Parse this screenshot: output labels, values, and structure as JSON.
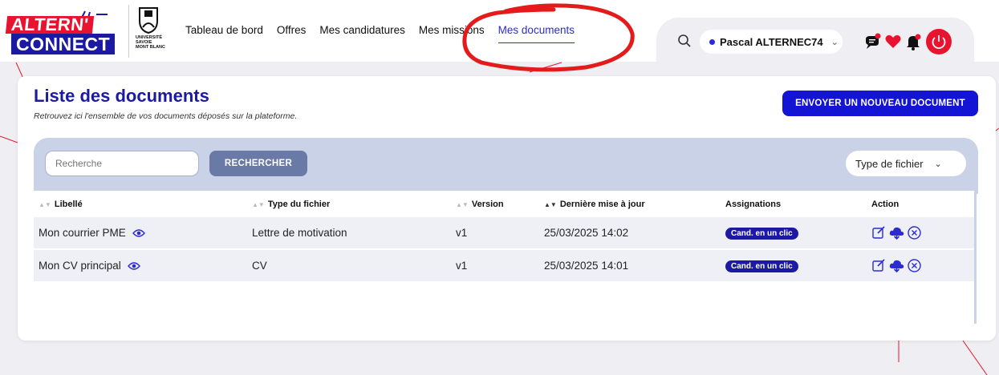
{
  "colors": {
    "brand_blue": "#1c1aa3",
    "brand_red": "#e8142f",
    "accent": "#2b2bd1",
    "panel": "#c9d2e6",
    "row": "#eef0f6"
  },
  "logo": {
    "line1": "ALTERN'",
    "line2": "CONNECT"
  },
  "university": {
    "line1": "UNIVERSITÉ",
    "line2": "SAVOIE",
    "line3": "MONT BLANC"
  },
  "nav": {
    "dashboard": "Tableau de bord",
    "offers": "Offres",
    "applications": "Mes candidatures",
    "missions": "Mes missions",
    "documents": "Mes documents"
  },
  "user": {
    "name": "Pascal ALTERNEC74"
  },
  "page": {
    "title": "Liste des documents",
    "subtitle": "Retrouvez ici l'ensemble de vos documents déposés sur la plateforme.",
    "send_button": "ENVOYER UN NOUVEAU DOCUMENT"
  },
  "search": {
    "placeholder": "Recherche",
    "button": "RECHERCHER",
    "type_filter": "Type de fichier"
  },
  "table": {
    "headers": {
      "label": "Libellé",
      "type": "Type du fichier",
      "version": "Version",
      "updated": "Dernière mise à jour",
      "assignments": "Assignations",
      "action": "Action"
    },
    "rows": [
      {
        "label": "Mon courrier PME",
        "type": "Lettre de motivation",
        "version": "v1",
        "updated": "25/03/2025 14:02",
        "assignment": "Cand. en un clic"
      },
      {
        "label": "Mon CV principal",
        "type": "CV",
        "version": "v1",
        "updated": "25/03/2025 14:01",
        "assignment": "Cand. en un clic"
      }
    ]
  },
  "icons": {
    "search": "search-icon",
    "chat": "chat-icon",
    "heart": "heart-icon",
    "bell": "bell-icon",
    "power": "power-icon",
    "eye": "eye-icon",
    "edit": "edit-icon",
    "download": "cloud-download-icon",
    "delete": "delete-circle-icon"
  }
}
